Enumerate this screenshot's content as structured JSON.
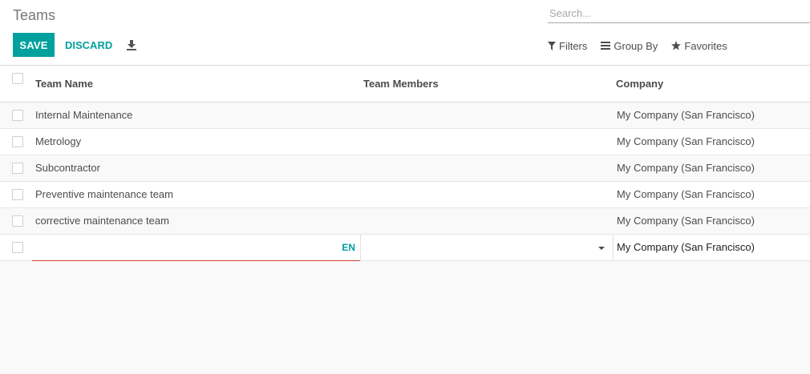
{
  "header": {
    "title": "Teams",
    "search_placeholder": "Search...",
    "save_label": "SAVE",
    "discard_label": "DISCARD",
    "download_icon": "download-icon",
    "filters_label": "Filters",
    "group_by_label": "Group By",
    "favorites_label": "Favorites"
  },
  "table": {
    "columns": [
      "Team Name",
      "Team Members",
      "Company"
    ],
    "rows": [
      {
        "name": "Internal Maintenance",
        "members": "",
        "company": "My Company (San Francisco)"
      },
      {
        "name": "Metrology",
        "members": "",
        "company": "My Company (San Francisco)"
      },
      {
        "name": "Subcontractor",
        "members": "",
        "company": "My Company (San Francisco)"
      },
      {
        "name": "Preventive maintenance team",
        "members": "",
        "company": "My Company (San Francisco)"
      },
      {
        "name": "corrective maintenance team",
        "members": "",
        "company": "My Company (San Francisco)"
      }
    ],
    "edit_row": {
      "name_value": "",
      "lang_label": "EN",
      "members_value": "",
      "company_value": "My Company (San Francisco)"
    }
  },
  "colors": {
    "accent": "#00a09d",
    "invalid_underline": "#d23f3a"
  }
}
